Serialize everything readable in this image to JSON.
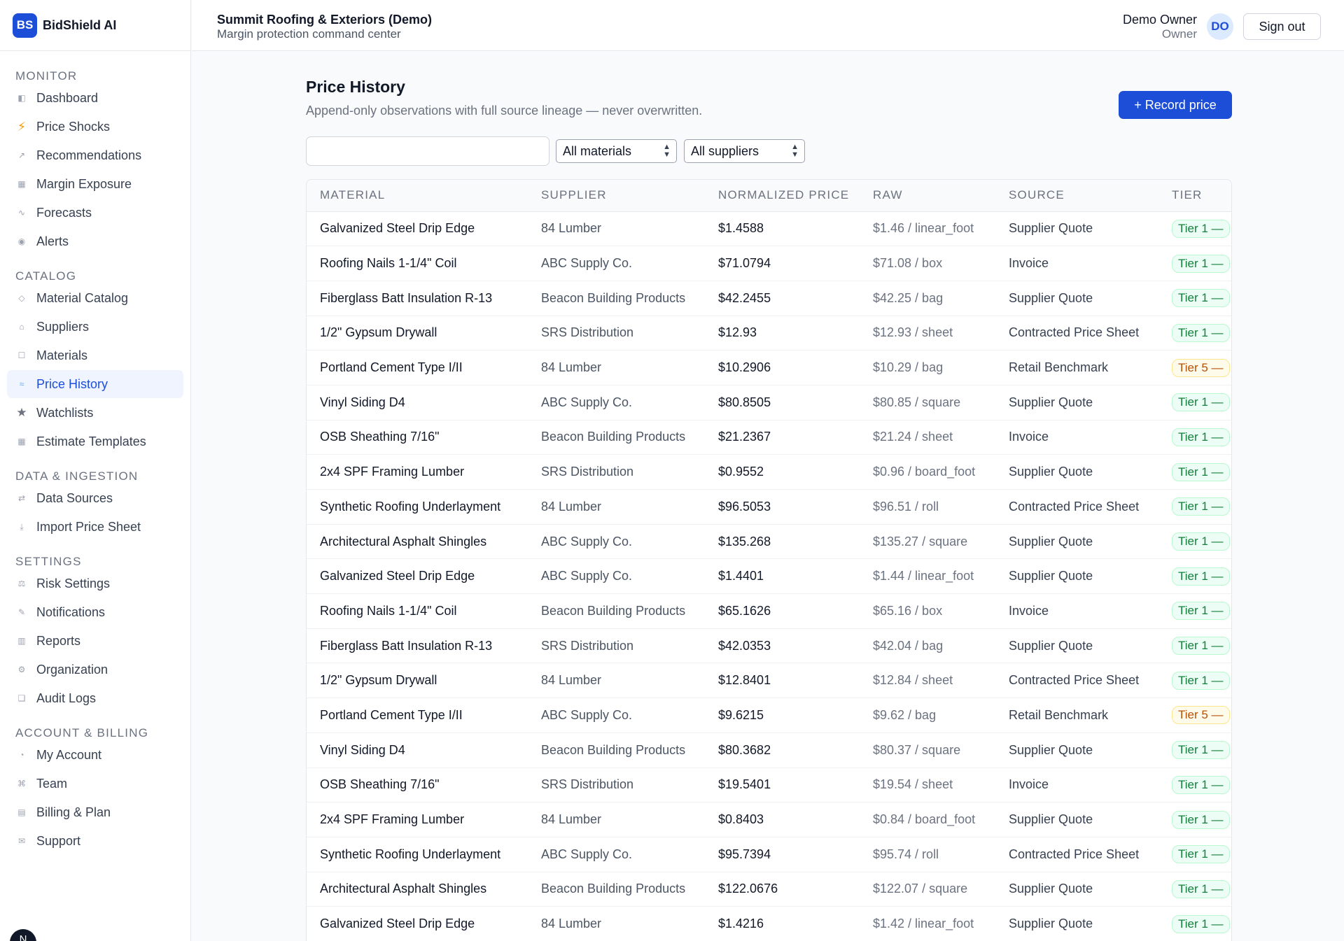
{
  "brand": {
    "logo": "BS",
    "name": "BidShield AI"
  },
  "sidebar": {
    "sections": [
      {
        "title": "MONITOR",
        "items": [
          {
            "label": "Dashboard",
            "icon": "dashboard-icon",
            "glyph": "◧"
          },
          {
            "label": "Price Shocks",
            "icon": "bolt-icon",
            "glyph": "⚡"
          },
          {
            "label": "Recommendations",
            "icon": "arrow-up-right-icon",
            "glyph": "↗"
          },
          {
            "label": "Margin Exposure",
            "icon": "grid-icon",
            "glyph": "▦"
          },
          {
            "label": "Forecasts",
            "icon": "wave-icon",
            "glyph": "∿"
          },
          {
            "label": "Alerts",
            "icon": "dot-icon",
            "glyph": "◉"
          }
        ]
      },
      {
        "title": "CATALOG",
        "items": [
          {
            "label": "Material Catalog",
            "icon": "diamond-icon",
            "glyph": "◇"
          },
          {
            "label": "Suppliers",
            "icon": "home-icon",
            "glyph": "⌂"
          },
          {
            "label": "Materials",
            "icon": "square-icon",
            "glyph": "☐"
          },
          {
            "label": "Price History",
            "icon": "approx-icon",
            "glyph": "≈",
            "active": true
          },
          {
            "label": "Watchlists",
            "icon": "star-icon",
            "glyph": "★"
          },
          {
            "label": "Estimate Templates",
            "icon": "template-icon",
            "glyph": "▦"
          }
        ]
      },
      {
        "title": "DATA & INGESTION",
        "items": [
          {
            "label": "Data Sources",
            "icon": "sync-icon",
            "glyph": "⇄"
          },
          {
            "label": "Import Price Sheet",
            "icon": "download-icon",
            "glyph": "⤓"
          }
        ]
      },
      {
        "title": "SETTINGS",
        "items": [
          {
            "label": "Risk Settings",
            "icon": "scale-icon",
            "glyph": "⚖"
          },
          {
            "label": "Notifications",
            "icon": "pencil-icon",
            "glyph": "✎"
          },
          {
            "label": "Reports",
            "icon": "report-icon",
            "glyph": "▥"
          },
          {
            "label": "Organization",
            "icon": "gear-icon",
            "glyph": "⚙"
          },
          {
            "label": "Audit Logs",
            "icon": "log-icon",
            "glyph": "❏"
          }
        ]
      },
      {
        "title": "ACCOUNT & BILLING",
        "items": [
          {
            "label": "My Account",
            "icon": "account-icon",
            "glyph": "◔"
          },
          {
            "label": "Team",
            "icon": "team-icon",
            "glyph": "⌘"
          },
          {
            "label": "Billing & Plan",
            "icon": "billing-icon",
            "glyph": "▤"
          },
          {
            "label": "Support",
            "icon": "mail-icon",
            "glyph": "✉"
          }
        ]
      }
    ],
    "bottom_avatar": "N"
  },
  "header": {
    "org_name": "Summit Roofing & Exteriors (Demo)",
    "org_subtitle": "Margin protection command center",
    "user_name": "Demo Owner",
    "user_role": "Owner",
    "user_initials": "DO",
    "signout_label": "Sign out"
  },
  "main": {
    "title": "Price History",
    "subtitle": "Append-only observations with full source lineage — never overwritten.",
    "record_button": "+ Record price",
    "search": {
      "value": "",
      "placeholder": ""
    },
    "material_filter": "All materials",
    "supplier_filter": "All suppliers",
    "columns": [
      "MATERIAL",
      "SUPPLIER",
      "NORMALIZED PRICE",
      "RAW",
      "SOURCE",
      "TIER"
    ],
    "rows": [
      {
        "material": "Galvanized Steel Drip Edge",
        "supplier": "84 Lumber",
        "price": "$1.4588",
        "raw": "$1.46 / linear_foot",
        "source": "Supplier Quote",
        "tier": "Tier 1 —",
        "tier_color": "green"
      },
      {
        "material": "Roofing Nails 1-1/4\" Coil",
        "supplier": "ABC Supply Co.",
        "price": "$71.0794",
        "raw": "$71.08 / box",
        "source": "Invoice",
        "tier": "Tier 1 —",
        "tier_color": "green"
      },
      {
        "material": "Fiberglass Batt Insulation R-13",
        "supplier": "Beacon Building Products",
        "price": "$42.2455",
        "raw": "$42.25 / bag",
        "source": "Supplier Quote",
        "tier": "Tier 1 —",
        "tier_color": "green"
      },
      {
        "material": "1/2\" Gypsum Drywall",
        "supplier": "SRS Distribution",
        "price": "$12.93",
        "raw": "$12.93 / sheet",
        "source": "Contracted Price Sheet",
        "tier": "Tier 1 —",
        "tier_color": "green"
      },
      {
        "material": "Portland Cement Type I/II",
        "supplier": "84 Lumber",
        "price": "$10.2906",
        "raw": "$10.29 / bag",
        "source": "Retail Benchmark",
        "tier": "Tier 5 —",
        "tier_color": "amber"
      },
      {
        "material": "Vinyl Siding D4",
        "supplier": "ABC Supply Co.",
        "price": "$80.8505",
        "raw": "$80.85 / square",
        "source": "Supplier Quote",
        "tier": "Tier 1 —",
        "tier_color": "green"
      },
      {
        "material": "OSB Sheathing 7/16\"",
        "supplier": "Beacon Building Products",
        "price": "$21.2367",
        "raw": "$21.24 / sheet",
        "source": "Invoice",
        "tier": "Tier 1 —",
        "tier_color": "green"
      },
      {
        "material": "2x4 SPF Framing Lumber",
        "supplier": "SRS Distribution",
        "price": "$0.9552",
        "raw": "$0.96 / board_foot",
        "source": "Supplier Quote",
        "tier": "Tier 1 —",
        "tier_color": "green"
      },
      {
        "material": "Synthetic Roofing Underlayment",
        "supplier": "84 Lumber",
        "price": "$96.5053",
        "raw": "$96.51 / roll",
        "source": "Contracted Price Sheet",
        "tier": "Tier 1 —",
        "tier_color": "green"
      },
      {
        "material": "Architectural Asphalt Shingles",
        "supplier": "ABC Supply Co.",
        "price": "$135.268",
        "raw": "$135.27 / square",
        "source": "Supplier Quote",
        "tier": "Tier 1 —",
        "tier_color": "green"
      },
      {
        "material": "Galvanized Steel Drip Edge",
        "supplier": "ABC Supply Co.",
        "price": "$1.4401",
        "raw": "$1.44 / linear_foot",
        "source": "Supplier Quote",
        "tier": "Tier 1 —",
        "tier_color": "green"
      },
      {
        "material": "Roofing Nails 1-1/4\" Coil",
        "supplier": "Beacon Building Products",
        "price": "$65.1626",
        "raw": "$65.16 / box",
        "source": "Invoice",
        "tier": "Tier 1 —",
        "tier_color": "green"
      },
      {
        "material": "Fiberglass Batt Insulation R-13",
        "supplier": "SRS Distribution",
        "price": "$42.0353",
        "raw": "$42.04 / bag",
        "source": "Supplier Quote",
        "tier": "Tier 1 —",
        "tier_color": "green"
      },
      {
        "material": "1/2\" Gypsum Drywall",
        "supplier": "84 Lumber",
        "price": "$12.8401",
        "raw": "$12.84 / sheet",
        "source": "Contracted Price Sheet",
        "tier": "Tier 1 —",
        "tier_color": "green"
      },
      {
        "material": "Portland Cement Type I/II",
        "supplier": "ABC Supply Co.",
        "price": "$9.6215",
        "raw": "$9.62 / bag",
        "source": "Retail Benchmark",
        "tier": "Tier 5 —",
        "tier_color": "amber"
      },
      {
        "material": "Vinyl Siding D4",
        "supplier": "Beacon Building Products",
        "price": "$80.3682",
        "raw": "$80.37 / square",
        "source": "Supplier Quote",
        "tier": "Tier 1 —",
        "tier_color": "green"
      },
      {
        "material": "OSB Sheathing 7/16\"",
        "supplier": "SRS Distribution",
        "price": "$19.5401",
        "raw": "$19.54 / sheet",
        "source": "Invoice",
        "tier": "Tier 1 —",
        "tier_color": "green"
      },
      {
        "material": "2x4 SPF Framing Lumber",
        "supplier": "84 Lumber",
        "price": "$0.8403",
        "raw": "$0.84 / board_foot",
        "source": "Supplier Quote",
        "tier": "Tier 1 —",
        "tier_color": "green"
      },
      {
        "material": "Synthetic Roofing Underlayment",
        "supplier": "ABC Supply Co.",
        "price": "$95.7394",
        "raw": "$95.74 / roll",
        "source": "Contracted Price Sheet",
        "tier": "Tier 1 —",
        "tier_color": "green"
      },
      {
        "material": "Architectural Asphalt Shingles",
        "supplier": "Beacon Building Products",
        "price": "$122.0676",
        "raw": "$122.07 / square",
        "source": "Supplier Quote",
        "tier": "Tier 1 —",
        "tier_color": "green"
      },
      {
        "material": "Galvanized Steel Drip Edge",
        "supplier": "84 Lumber",
        "price": "$1.4216",
        "raw": "$1.42 / linear_foot",
        "source": "Supplier Quote",
        "tier": "Tier 1 —",
        "tier_color": "green"
      }
    ]
  },
  "colors": {
    "accent": "#1d4ed8",
    "tier_green": "#15803d",
    "tier_amber": "#b45309"
  }
}
